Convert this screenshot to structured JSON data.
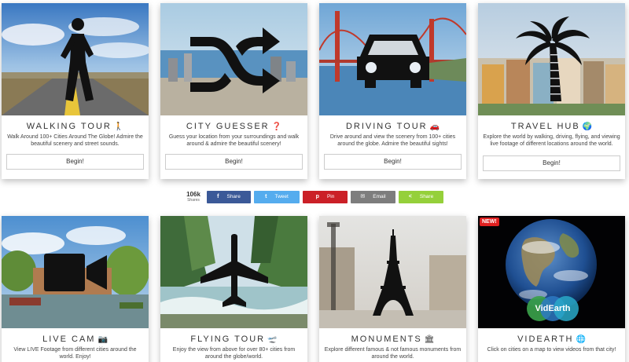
{
  "cards_top": [
    {
      "title": "WALKING TOUR",
      "emoji": "🚶",
      "desc": "Walk Around 100+ Cities Around The Globe! Admire the beautiful scenery and street sounds.",
      "button": "Begin!",
      "icon": "walking-person-icon"
    },
    {
      "title": "CITY GUESSER",
      "emoji": "❓",
      "desc": "Guess your location from your surroundings and walk around & admire the beautiful scenery!",
      "button": "Begin!",
      "icon": "shuffle-icon"
    },
    {
      "title": "DRIVING TOUR",
      "emoji": "🚗",
      "desc": "Drive around and view the scenery from 100+ cities around the globe. Admire the beautiful sights!",
      "button": "Begin!",
      "icon": "car-icon"
    },
    {
      "title": "TRAVEL HUB",
      "emoji": "🌍",
      "desc": "Explore the world by walking, driving, flying, and viewing live footage of different locations around the world.",
      "button": "Begin!",
      "icon": "palm-tree-icon"
    }
  ],
  "cards_bottom": [
    {
      "title": "LIVE CAM",
      "emoji": "📷",
      "desc": "View LIVE Footage from different cities around the world. Enjoy!",
      "icon": "video-camera-icon"
    },
    {
      "title": "FLYING TOUR",
      "emoji": "🛫",
      "desc": "Enjoy the view from above for over 80+ cities from around the globe/world.",
      "icon": "airplane-icon"
    },
    {
      "title": "MONUMENTS",
      "emoji": "🏛",
      "desc": "Explore different famous & not famous monuments from around the world.",
      "icon": "eiffel-tower-icon"
    },
    {
      "title": "VIDEARTH",
      "emoji": "🌐",
      "desc": "Click on cities on a map to view videos from that city!",
      "icon": "earth-globe-icon",
      "badge": "NEW!",
      "logo": "VidEarth"
    }
  ],
  "share": {
    "count": "106k",
    "count_label": "Shares",
    "buttons": [
      {
        "label": "Share",
        "network": "facebook",
        "icon_char": "f",
        "color": "#3b5998"
      },
      {
        "label": "Tweet",
        "network": "twitter",
        "icon_char": "t",
        "color": "#55acee"
      },
      {
        "label": "Pin",
        "network": "pinterest",
        "icon_char": "p",
        "color": "#cb2027"
      },
      {
        "label": "Email",
        "network": "email",
        "icon_char": "✉",
        "color": "#7d7d7d"
      },
      {
        "label": "Share",
        "network": "sharethis",
        "icon_char": "<",
        "color": "#95d03a"
      }
    ]
  }
}
